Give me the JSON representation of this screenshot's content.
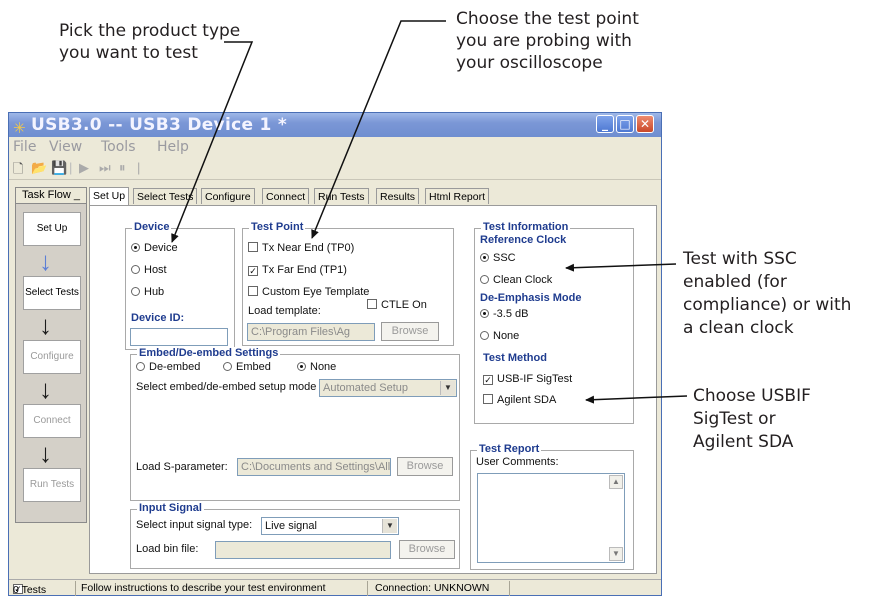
{
  "callouts": {
    "product_type": [
      "Pick the product type",
      "you want to test"
    ],
    "test_point": [
      "Choose the test point",
      "you are probing with",
      "your oscilloscope"
    ],
    "ssc": [
      "Test with SSC",
      "enabled (for",
      "compliance) or with",
      "a clean clock"
    ],
    "method": [
      "Choose USBIF",
      "SigTest or",
      "Agilent SDA"
    ]
  },
  "window": {
    "title": "USB3.0 -- USB3 Device 1 *",
    "menus": [
      "File",
      "View",
      "Tools",
      "Help"
    ]
  },
  "task_flow": {
    "header": "Task Flow",
    "steps": [
      {
        "label": "Set Up",
        "enabled": true
      },
      {
        "label": "Select Tests",
        "enabled": true
      },
      {
        "label": "Configure",
        "enabled": false
      },
      {
        "label": "Connect",
        "enabled": false
      },
      {
        "label": "Run Tests",
        "enabled": false
      }
    ]
  },
  "tabs": [
    "Set Up",
    "Select Tests",
    "Configure",
    "Connect",
    "Run Tests",
    "Results",
    "Html Report"
  ],
  "active_tab": "Set Up",
  "device": {
    "title": "Device",
    "options": [
      "Device",
      "Host",
      "Hub"
    ],
    "selected": "Device",
    "id_label": "Device ID:",
    "id_value": ""
  },
  "test_point": {
    "title": "Test Point",
    "tx_near": "Tx Near End (TP0)",
    "tx_near_checked": false,
    "tx_far": "Tx Far End (TP1)",
    "tx_far_checked": true,
    "custom_eye": "Custom Eye Template",
    "custom_eye_checked": false,
    "load_template": "Load template:",
    "ctle": "CTLE On",
    "ctle_checked": false,
    "template_path": "C:\\Program Files\\Ag",
    "browse": "Browse"
  },
  "test_info": {
    "title": "Test Information",
    "ref_clock_label": "Reference Clock",
    "ssc": "SSC",
    "clean_clock": "Clean Clock",
    "ref_clock_selected": "SSC",
    "deemph_label": "De-Emphasis Mode",
    "deemph_35": "-3.5 dB",
    "deemph_none": "None",
    "deemph_selected": "-3.5 dB",
    "method_label": "Test Method",
    "usbif": "USB-IF SigTest",
    "usbif_checked": true,
    "agilent": "Agilent SDA",
    "agilent_checked": false
  },
  "embed": {
    "title": "Embed/De-embed Settings",
    "de_embed": "De-embed",
    "embed": "Embed",
    "none": "None",
    "selected": "None",
    "mode_label": "Select embed/de-embed setup mode",
    "mode_value": "Automated Setup",
    "sparam_label": "Load S-parameter:",
    "sparam_path": "C:\\Documents and Settings\\All",
    "browse": "Browse"
  },
  "input_signal": {
    "title": "Input Signal",
    "type_label": "Select input signal type:",
    "type_value": "Live signal",
    "bin_label": "Load bin file:",
    "bin_value": "",
    "browse": "Browse"
  },
  "report": {
    "title": "Test Report",
    "comments_label": "User Comments:",
    "comments": ""
  },
  "status": {
    "tests": "0 Tests",
    "message": "Follow instructions to describe your test environment",
    "connection": "Connection: UNKNOWN"
  }
}
